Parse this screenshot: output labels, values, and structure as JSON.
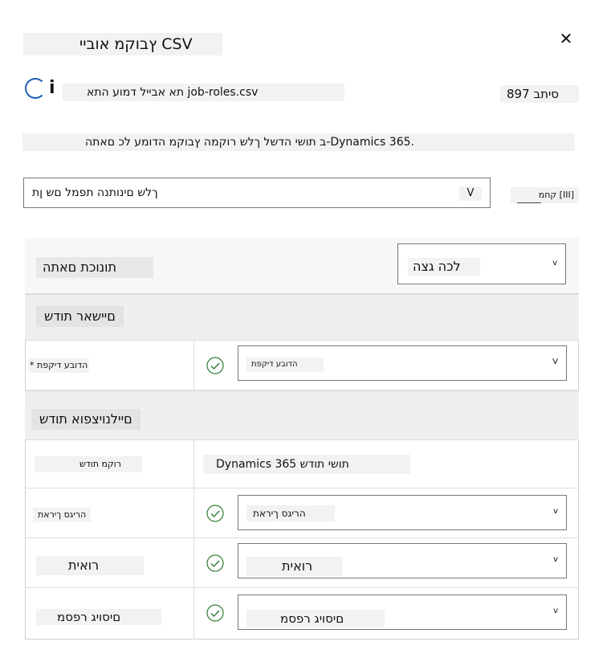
{
  "dialog": {
    "title": "ץבוקמ אוביי CSV",
    "close_glyph": "✕",
    "info_letter": "i",
    "file_label": "תא אבייל דמוע התא job-roles.csv",
    "rows_label": "סיתב 897",
    "description": "ב תושי הדשל ךלש רוקמה ץבוקמ הדומע לכ םאתה-Dynamics 365.",
    "mapping_select": {
      "value": "ךלש םינותנה תפמל םש ןת",
      "chevron": "V"
    },
    "save_label": "קחמ [III]"
  },
  "panel": {
    "sheet_label": "תונוכת םאתה",
    "sheet_select": {
      "value": "לכה גצה",
      "chevron": "v"
    },
    "sections": [
      {
        "title": "םיישאר תודש",
        "rows": [
          {
            "source": "* הדובע דיקפת",
            "target": "הדובע דיקפת",
            "chevron": "V"
          }
        ]
      },
      {
        "title": "םיילנויצפוא תודש",
        "header": {
          "source": "רוקמ תודש",
          "target": "Dynamics 365 תושי תודש"
        },
        "rows": [
          {
            "source": "הריגס ךיראת",
            "target": "הריגס ךיראת",
            "chevron": "v"
          },
          {
            "source": "רואית",
            "target": "רואית",
            "chevron": "v"
          },
          {
            "source": "םיסויג רפסמ",
            "target": "םיסויג רפסמ",
            "chevron": "v"
          }
        ]
      }
    ]
  },
  "colors": {
    "accent": "#1e5fb4",
    "check": "#2e7d32",
    "shade": "#f2f2f2"
  }
}
